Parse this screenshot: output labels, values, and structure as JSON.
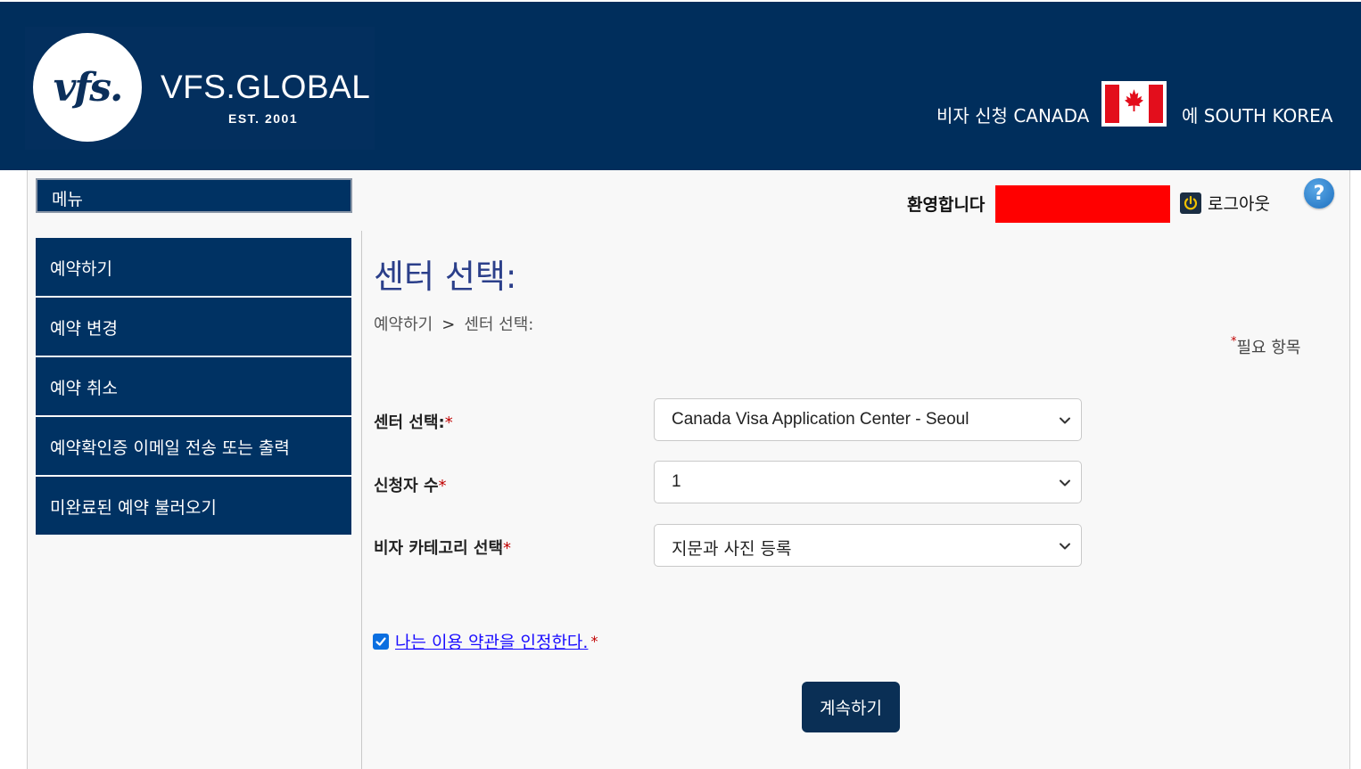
{
  "header": {
    "logo_mark": "vfs.",
    "logo_name": "VFS.GLOBAL",
    "logo_est": "EST. 2001",
    "visa_label": "비자 신청 CANADA",
    "country_label": "에 SOUTH KOREA"
  },
  "sidebar": {
    "menu_title": "메뉴",
    "items": [
      {
        "label": "예약하기"
      },
      {
        "label": "예약 변경"
      },
      {
        "label": "예약 취소"
      },
      {
        "label": "예약확인증 이메일 전송 또는 출력"
      },
      {
        "label": "미완료된 예약 불러오기"
      }
    ]
  },
  "topbar": {
    "welcome": "환영합니다",
    "logout": "로그아웃",
    "help": "?"
  },
  "main": {
    "title": "센터 선택:",
    "breadcrumb": [
      "예약하기",
      ">",
      "센터 선택:"
    ],
    "required_note": "필요 항목",
    "required_star": "*"
  },
  "form": {
    "center_label": "센터 선택:",
    "center_value": "Canada Visa Application Center - Seoul",
    "applicants_label": "신청자 수",
    "applicants_value": "1",
    "category_label": "비자 카테고리 선택",
    "category_value": "지문과 사진 등록",
    "star": "*"
  },
  "terms": {
    "label": "나는 이용 약관을 인정한다. ",
    "checked": true
  },
  "actions": {
    "continue": "계속하기"
  },
  "colors": {
    "header_bg": "#002e5c",
    "menu_bg": "#003263",
    "title": "#2b3f8a",
    "required": "#c00000",
    "link": "#1a0dff",
    "button_bg": "#0a2f55",
    "redaction": "#ff0000"
  }
}
